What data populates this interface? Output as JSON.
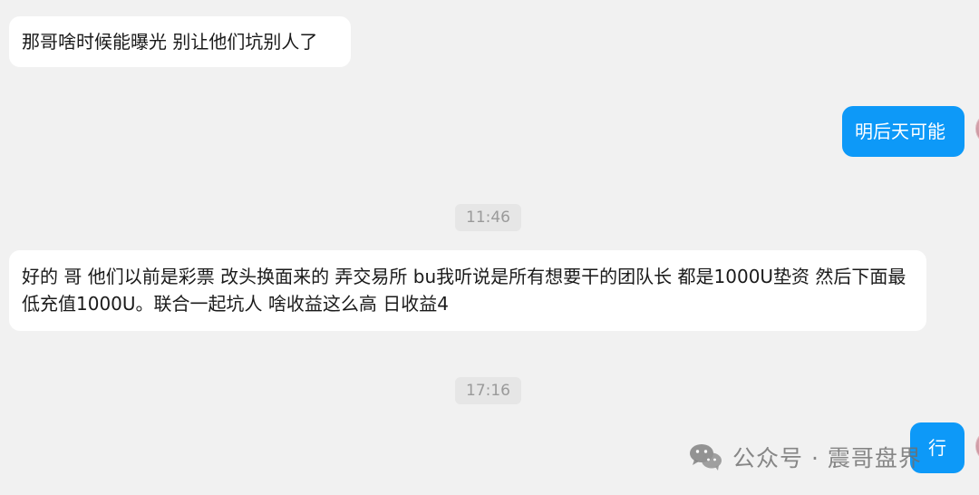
{
  "messages": [
    {
      "side": "left",
      "text": "那哥啥时候能曝光 别让他们坑别人了"
    },
    {
      "side": "right",
      "text": "明后天可能"
    },
    {
      "side": "left",
      "text": "好的 哥   他们以前是彩票  改头换面来的  弄交易所  bu我听说是所有想要干的团队长 都是1000U垫资  然后下面最低充值1000U。联合一起坑人 啥收益这么高   日收益4"
    },
    {
      "side": "right",
      "text": "行"
    }
  ],
  "timestamps": [
    "11:46",
    "17:16"
  ],
  "watermark": {
    "text": "公众号 · 震哥盘界",
    "icon": "wechat-icon"
  }
}
